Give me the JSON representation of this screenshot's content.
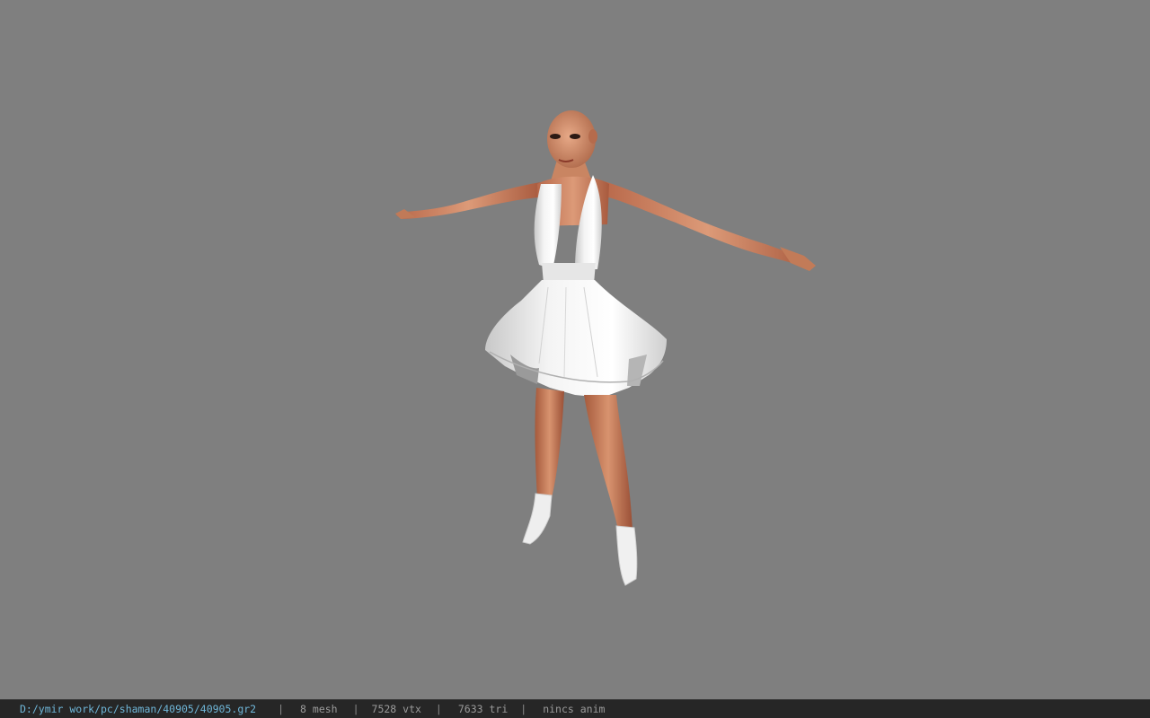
{
  "viewer": {
    "background_color": "#7f7f7f",
    "model_subject": "female-character-white-dress-t-pose"
  },
  "statusbar": {
    "path": "D:/ymir work/pc/shaman/40905/40905.gr2",
    "separator": "|",
    "mesh": "8 mesh",
    "vtx": "7528 vtx",
    "tri": "7633 tri",
    "anim": "nincs anim",
    "path_color": "#6fb6d8",
    "text_color": "#9a9a9a"
  }
}
